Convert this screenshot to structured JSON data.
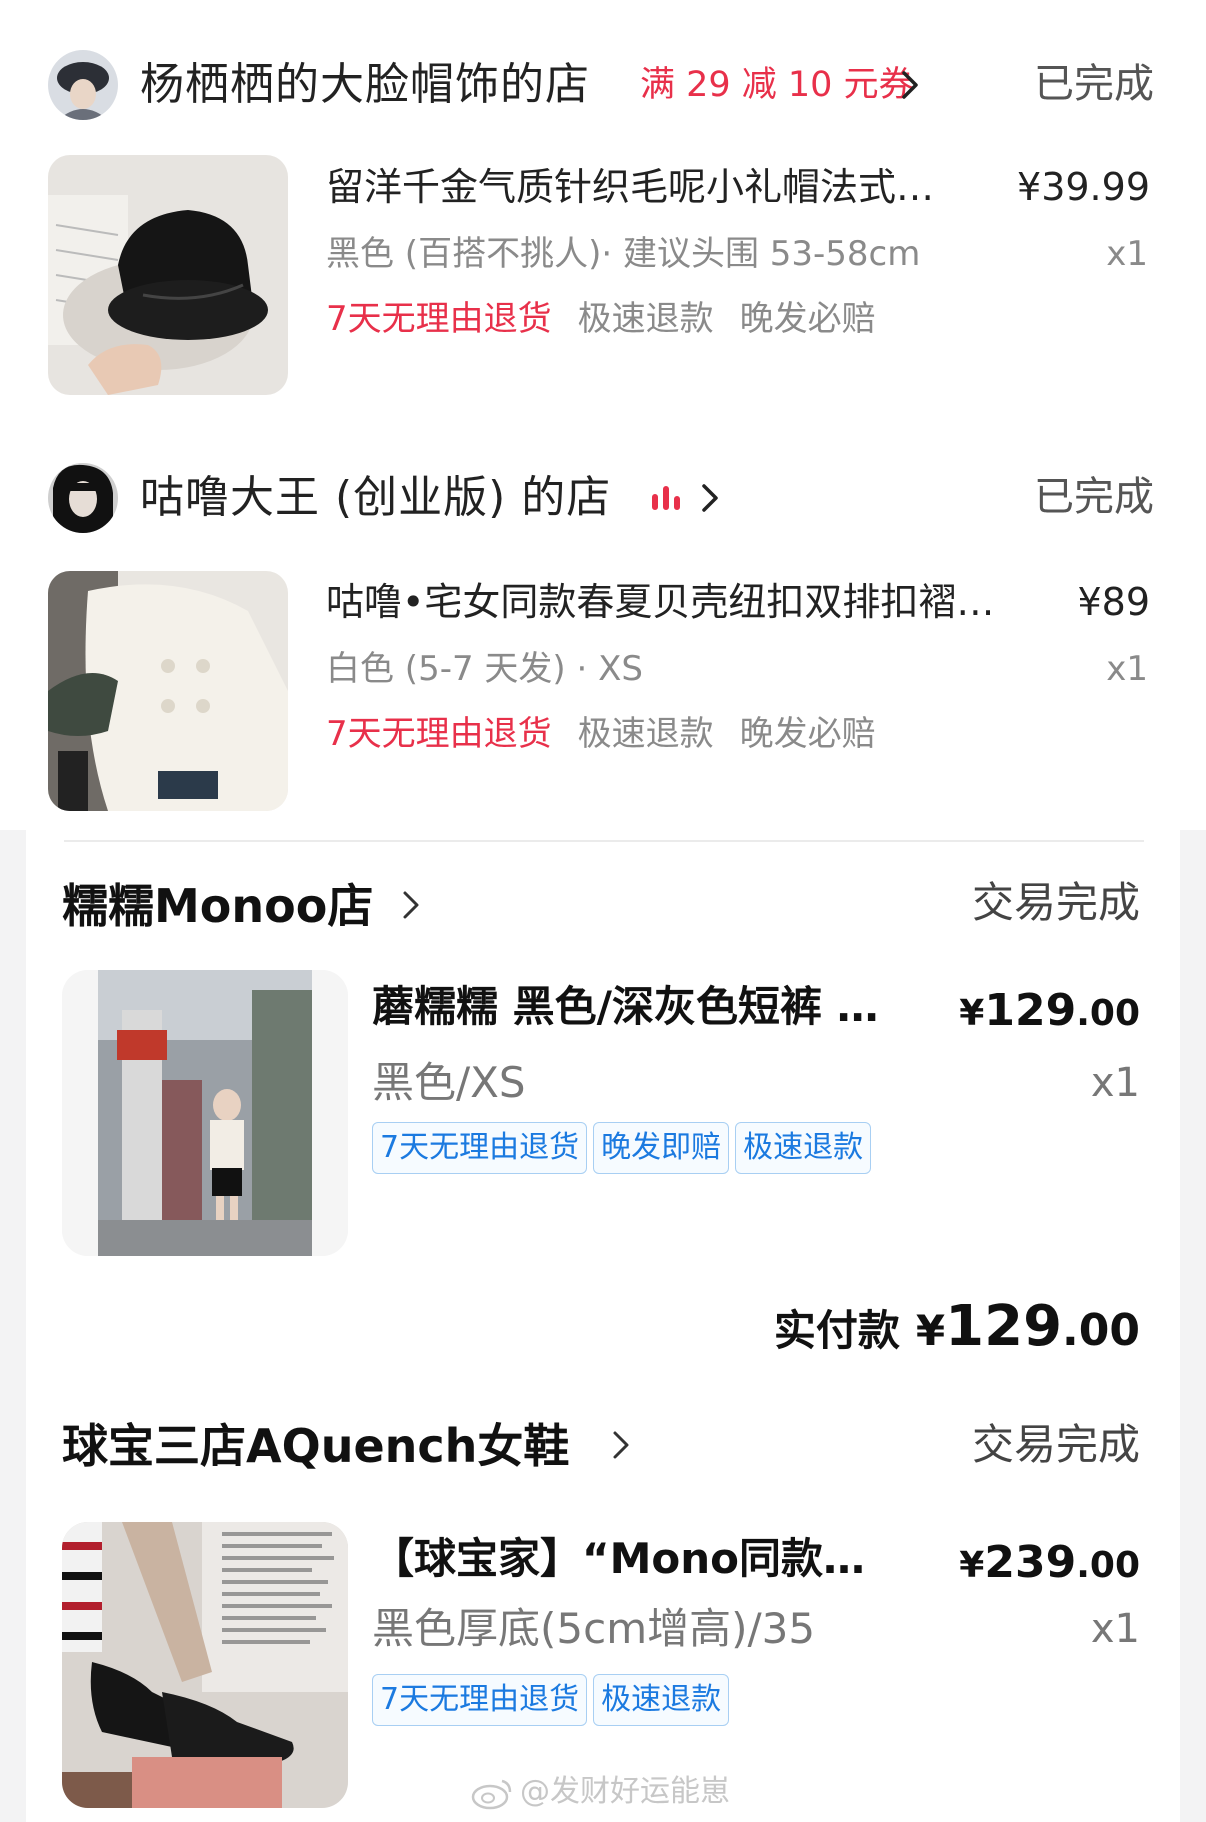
{
  "shops_top": [
    {
      "name": "杨栖栖的大脸帽饰的店",
      "coupon": "满 29 减 10 元券",
      "status": "已完成",
      "product": {
        "title": "留洋千金气质针织毛呢小礼帽法式…",
        "price": "¥39.99",
        "spec": "黑色 (百搭不挑人)· 建议头围 53-58cm",
        "qty": "x1",
        "tags": [
          "7天无理由退货",
          "极速退款",
          "晚发必赔"
        ]
      }
    },
    {
      "name": "咕噜大王 (创业版) 的店",
      "status": "已完成",
      "product": {
        "title": "咕噜•宅女同款春夏贝壳纽扣双排扣褶…",
        "price": "¥89",
        "spec": "白色 (5-7 天发) · XS",
        "qty": "x1",
        "tags": [
          "7天无理由退货",
          "极速退款",
          "晚发必赔"
        ]
      }
    }
  ],
  "shops_bottom": [
    {
      "name": "糯糯Monoo店",
      "status": "交易完成",
      "product": {
        "title": "蘑糯糯 黑色/深灰色短裤 …",
        "price_yen": "¥",
        "price_int": "129",
        "price_dec": ".00",
        "spec": "黑色/XS",
        "qty": "x1",
        "tags": [
          "7天无理由退货",
          "晚发即赔",
          "极速退款"
        ]
      },
      "paid_label": "实付款",
      "paid_yen": "¥",
      "paid_int": "129",
      "paid_dec": ".00"
    },
    {
      "name": "球宝三店AQuench女鞋",
      "status": "交易完成",
      "product": {
        "title": "【球宝家】“Mono同款…",
        "price_yen": "¥",
        "price_int": "239",
        "price_dec": ".00",
        "spec": "黑色厚底(5cm增高)/35",
        "qty": "x1",
        "tags": [
          "7天无理由退货",
          "极速退款"
        ]
      }
    }
  ],
  "watermark": "@发财好运能崽",
  "icons": {
    "chevron": "chevron-right-icon",
    "live": "live-bars-icon",
    "weibo": "weibo-icon"
  },
  "colors": {
    "accent_red": "#e8304a",
    "tag_blue": "#1b7ae0",
    "tag_border": "#a8cff3",
    "frame_grey": "#f3f3f4"
  }
}
